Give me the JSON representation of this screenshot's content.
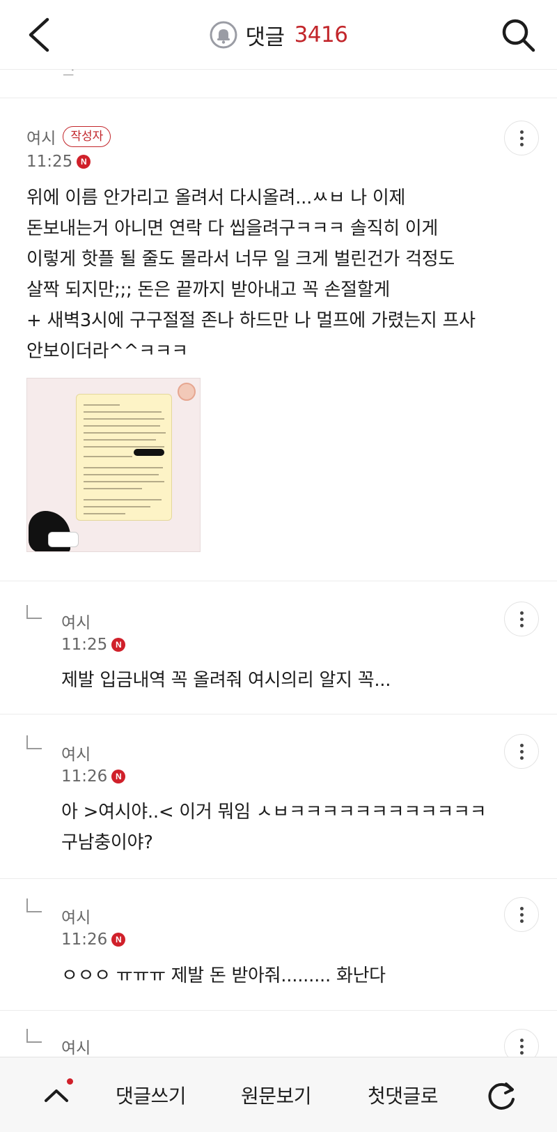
{
  "header": {
    "title": "댓글",
    "count": "3416",
    "accent_color": "#c2262b",
    "icons": {
      "back": "chevron-left-icon",
      "bell": "bell-icon",
      "search": "search-icon"
    }
  },
  "previous_comment_tail": "ㅋㅋ",
  "comments": [
    {
      "author": "여시",
      "badge": "작성자",
      "time": "11:25",
      "new_badge": "N",
      "lines": [
        "위에 이름 안가리고 올려서 다시올려...ㅆㅂ 나 이제",
        "돈보내는거 아니면 연락 다 씹을려구ㅋㅋㅋ 솔직히 이게",
        "이렇게 핫플 될 줄도 몰라서 너무 일 크게 벌린건가 걱정도",
        "살짝 되지만;;; 돈은 끝까지 받아내고 꼭 손절할게",
        "+ 새벽3시에 구구절절 존나 하드만 나 멀프에 가렸는지 프사",
        "안보이더라^^ㅋㅋㅋ"
      ],
      "has_image": true
    },
    {
      "author": "여시",
      "time": "11:25",
      "new_badge": "N",
      "lines": [
        "제발 입금내역 꼭 올려줘 여시의리 알지 꼭..."
      ]
    },
    {
      "author": "여시",
      "time": "11:26",
      "new_badge": "N",
      "lines": [
        "아 >여시야..< 이거 뭐임 ㅅㅂㅋㅋㅋㅋㅋㅋㅋㅋㅋㅋㅋㅋ",
        "구남충이야?"
      ]
    },
    {
      "author": "여시",
      "time": "11:26",
      "new_badge": "N",
      "lines": [
        "ㅇㅇㅇ ㅠㅠㅠ 제발 돈 받아줘......... 화난다"
      ]
    },
    {
      "author": "여시"
    }
  ],
  "bottom_bar": {
    "write_label": "댓글쓰기",
    "original_label": "원문보기",
    "first_label": "첫댓글로",
    "icons": {
      "up": "chevron-up-icon",
      "refresh": "refresh-icon"
    }
  }
}
